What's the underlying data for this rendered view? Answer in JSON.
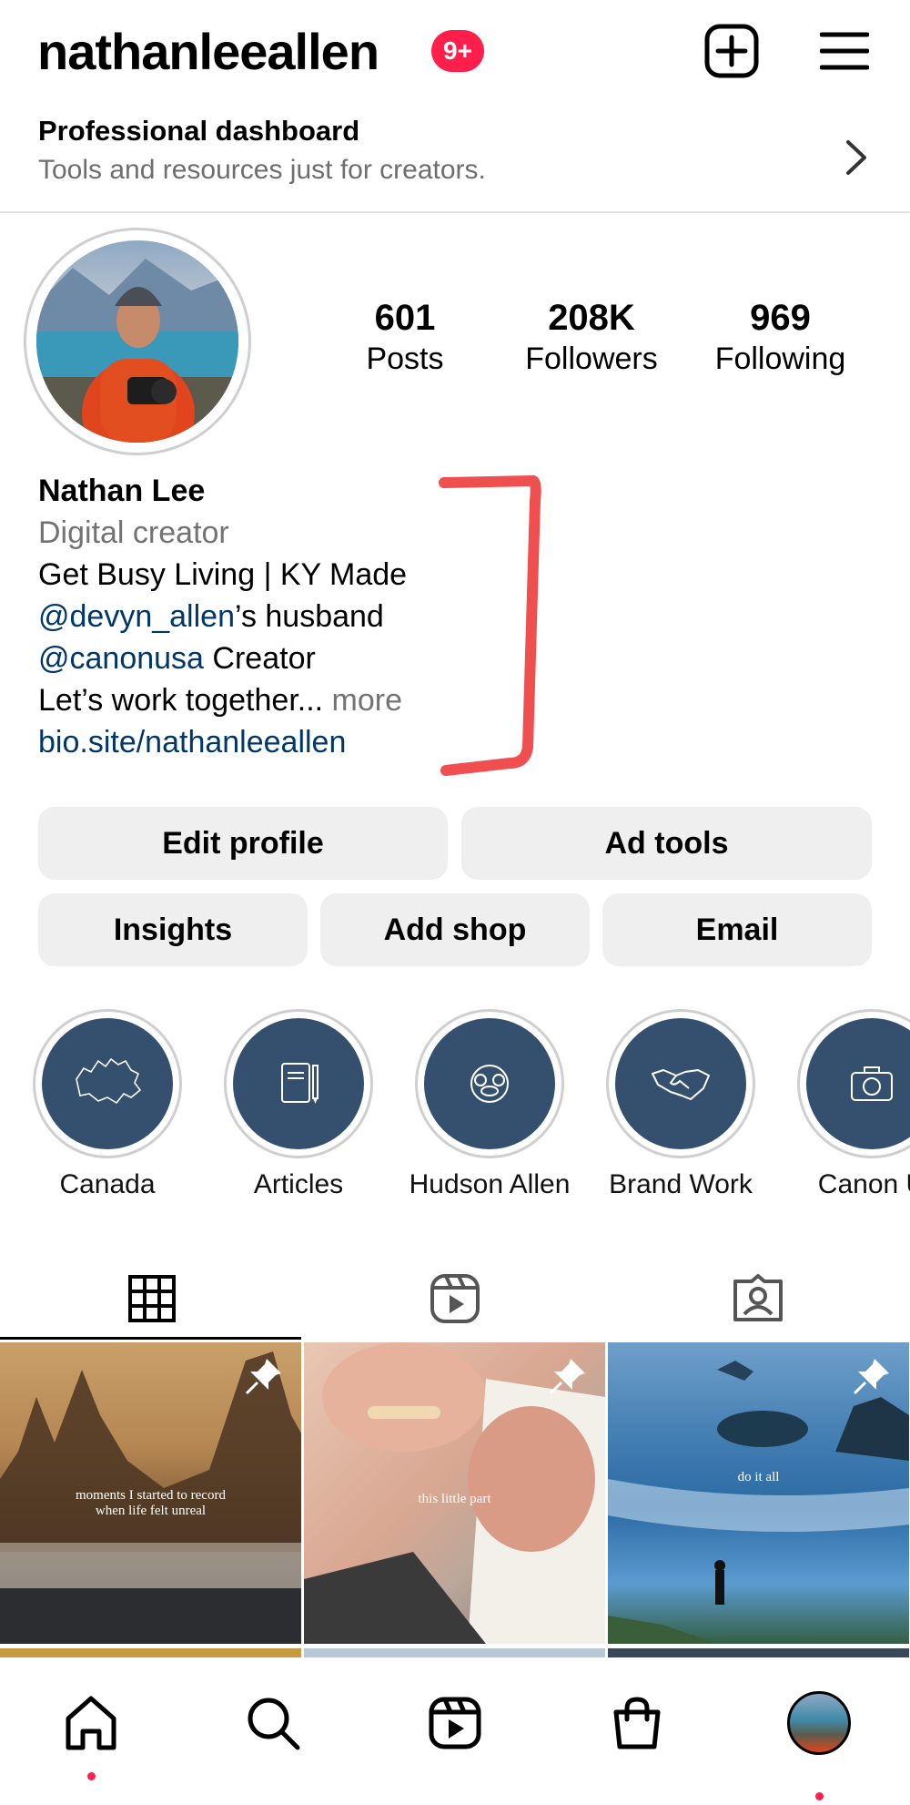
{
  "header": {
    "username": "nathanleeallen",
    "notification_badge": "9+",
    "accent_color": "#ff1f4a"
  },
  "dashboard": {
    "title": "Professional dashboard",
    "subtitle": "Tools and resources just for creators."
  },
  "stats": {
    "posts": {
      "value": "601",
      "label": "Posts"
    },
    "followers": {
      "value": "208K",
      "label": "Followers"
    },
    "following": {
      "value": "969",
      "label": "Following"
    }
  },
  "bio": {
    "name": "Nathan Lee",
    "category": "Digital creator",
    "line1": "Get Busy Living | KY Made",
    "mention1": "@devyn_allen",
    "mention1_suffix": "’s husband",
    "mention2": "@canonusa",
    "mention2_suffix": " Creator",
    "line4": "Let’s work together...",
    "more": " more",
    "link": "bio.site/nathanleeallen",
    "link_color": "#00376b"
  },
  "buttons": {
    "edit_profile": "Edit profile",
    "ad_tools": "Ad tools",
    "insights": "Insights",
    "add_shop": "Add shop",
    "email": "Email"
  },
  "highlights": [
    {
      "label": "Canada",
      "icon": "canada-map-icon"
    },
    {
      "label": "Articles",
      "icon": "notebook-icon"
    },
    {
      "label": "Hudson Allen",
      "icon": "pacifier-icon"
    },
    {
      "label": "Brand Work",
      "icon": "handshake-icon"
    },
    {
      "label": "Canon U",
      "icon": "camera-icon"
    }
  ],
  "tabs": [
    {
      "name": "grid",
      "icon": "grid-icon",
      "active": true
    },
    {
      "name": "reels",
      "icon": "reels-icon",
      "active": false
    },
    {
      "name": "tagged",
      "icon": "tagged-icon",
      "active": false
    }
  ],
  "posts": [
    {
      "caption_line1": "moments I started to record",
      "caption_line2": "when life felt unreal",
      "pinned": true
    },
    {
      "caption_line1": "this little part",
      "caption_line2": "",
      "pinned": true
    },
    {
      "caption_line1": "do it all",
      "caption_line2": "",
      "pinned": true
    }
  ],
  "bottom_nav": [
    {
      "name": "home",
      "icon": "home-icon",
      "active": true
    },
    {
      "name": "search",
      "icon": "search-icon"
    },
    {
      "name": "reels",
      "icon": "reels-icon"
    },
    {
      "name": "shop",
      "icon": "shopping-bag-icon"
    },
    {
      "name": "profile",
      "icon": "profile-avatar-icon"
    }
  ]
}
